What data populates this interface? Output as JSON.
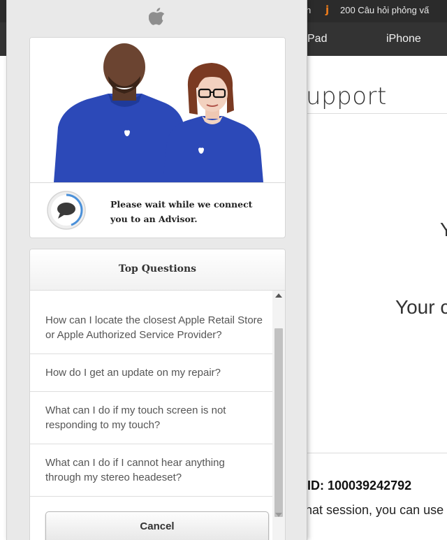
{
  "background": {
    "bookmarks": {
      "fragment": "h",
      "item_label": "200 Câu hỏi phỏng vấ"
    },
    "nav": {
      "ipad_label": "Pad",
      "iphone_label": "iPhone"
    },
    "page_title_fragment": "upport",
    "heading_fragment_1": "Y",
    "heading_fragment_2": "Your c",
    "session_id_text": "ID: 100039242792",
    "session_text": "hat session, you can use"
  },
  "chat": {
    "connect_message": "Please wait while we connect you to an Advisor.",
    "top_questions_title": "Top Questions",
    "questions": [
      "How can I locate the closest Apple Retail Store or Apple Authorized Service Provider?",
      "How do I get an update on my repair?",
      "What can I do if my touch screen is not responding to my touch?",
      "What can I do if I cannot hear anything through my stereo headeset?"
    ],
    "cancel_label": "Cancel"
  },
  "colors": {
    "nav_background": "#333333",
    "bookmark_bar": "#2b2b2b",
    "apple_shirt_blue": "#2c49b8",
    "spinner_blue": "#4a90d9"
  },
  "icons": [
    "apple-logo-icon",
    "chat-bubble-icon",
    "bookmark-j-icon"
  ]
}
